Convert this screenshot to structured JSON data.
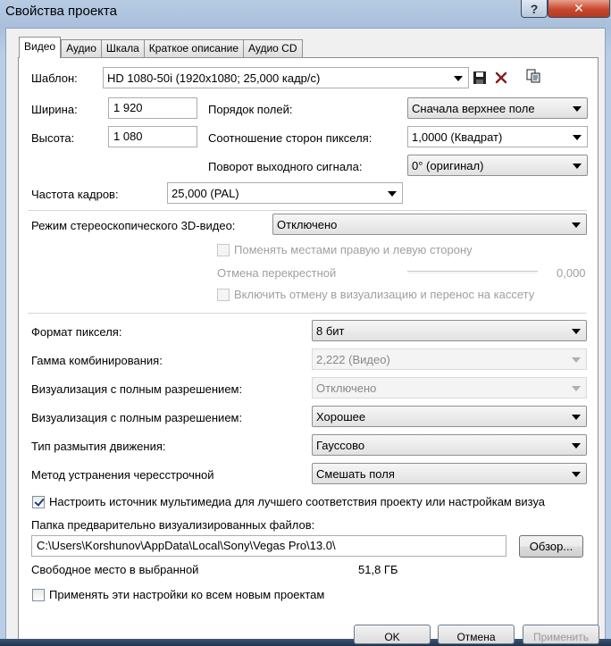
{
  "window": {
    "title": "Свойства проекта",
    "help_label": "?",
    "close_label": "✕"
  },
  "tabs": [
    {
      "label": "Видео",
      "active": true
    },
    {
      "label": "Аудио",
      "active": false
    },
    {
      "label": "Шкала",
      "active": false
    },
    {
      "label": "Краткое описание",
      "active": false
    },
    {
      "label": "Аудио CD",
      "active": false
    }
  ],
  "template": {
    "label": "Шаблон:",
    "value": "HD 1080-50i (1920x1080; 25,000 кадр/с)",
    "icons": [
      "save-icon",
      "delete-icon",
      "copy-icon"
    ]
  },
  "width": {
    "label": "Ширина:",
    "value": "1 920"
  },
  "height": {
    "label": "Высота:",
    "value": "1 080"
  },
  "field_order": {
    "label": "Порядок полей:",
    "value": "Сначала верхнее поле"
  },
  "pixel_aspect": {
    "label": "Соотношение сторон пикселя:",
    "value": "1,0000 (Квадрат)"
  },
  "output_rotation": {
    "label": "Поворот выходного сигнала:",
    "value": "0° (оригинал)"
  },
  "frame_rate": {
    "label": "Частота кадров:",
    "value": "25,000 (PAL)"
  },
  "stereo_mode": {
    "label": "Режим стереоскопического 3D-видео:",
    "value": "Отключено"
  },
  "swap_left_right": {
    "label": "Поменять местами правую и левую сторону",
    "checked": false,
    "enabled": false
  },
  "crosstalk": {
    "label": "Отмена перекрестной",
    "value": "0,000",
    "enabled": false
  },
  "crosstalk_render": {
    "label": "Включить отмену в визуализацию и перенос на кассету",
    "checked": false,
    "enabled": false
  },
  "pixel_format": {
    "label": "Формат пикселя:",
    "value": "8 бит"
  },
  "compositing_gamma": {
    "label": "Гамма комбинирования:",
    "value": "2,222 (Видео)",
    "enabled": false
  },
  "full_res_view": {
    "label": "Визуализация с полным разрешением:",
    "value": "Отключено",
    "enabled": false
  },
  "full_res_quality": {
    "label": "Визуализация с полным разрешением:",
    "value": "Хорошее"
  },
  "motion_blur": {
    "label": "Тип размытия движения:",
    "value": "Гауссово"
  },
  "deinterlace": {
    "label": "Метод устранения чересстрочной",
    "value": "Смешать поля"
  },
  "adjust_source": {
    "label": "Настроить источник мультимедиа для лучшего соответствия проекту или настройкам визуа",
    "checked": true
  },
  "prerender_folder": {
    "label": "Папка предварительно визуализированных файлов:",
    "value": "C:\\Users\\Korshunov\\AppData\\Local\\Sony\\Vegas Pro\\13.0\\",
    "browse_label": "Обзор..."
  },
  "free_space": {
    "label": "Свободное место в выбранной",
    "value": "51,8 ГБ"
  },
  "apply_all": {
    "label": "Применять эти настройки ко всем новым проектам",
    "checked": false
  },
  "footer": {
    "ok_label": "OK",
    "cancel_label": "Отмена",
    "apply_label": "Применить"
  }
}
